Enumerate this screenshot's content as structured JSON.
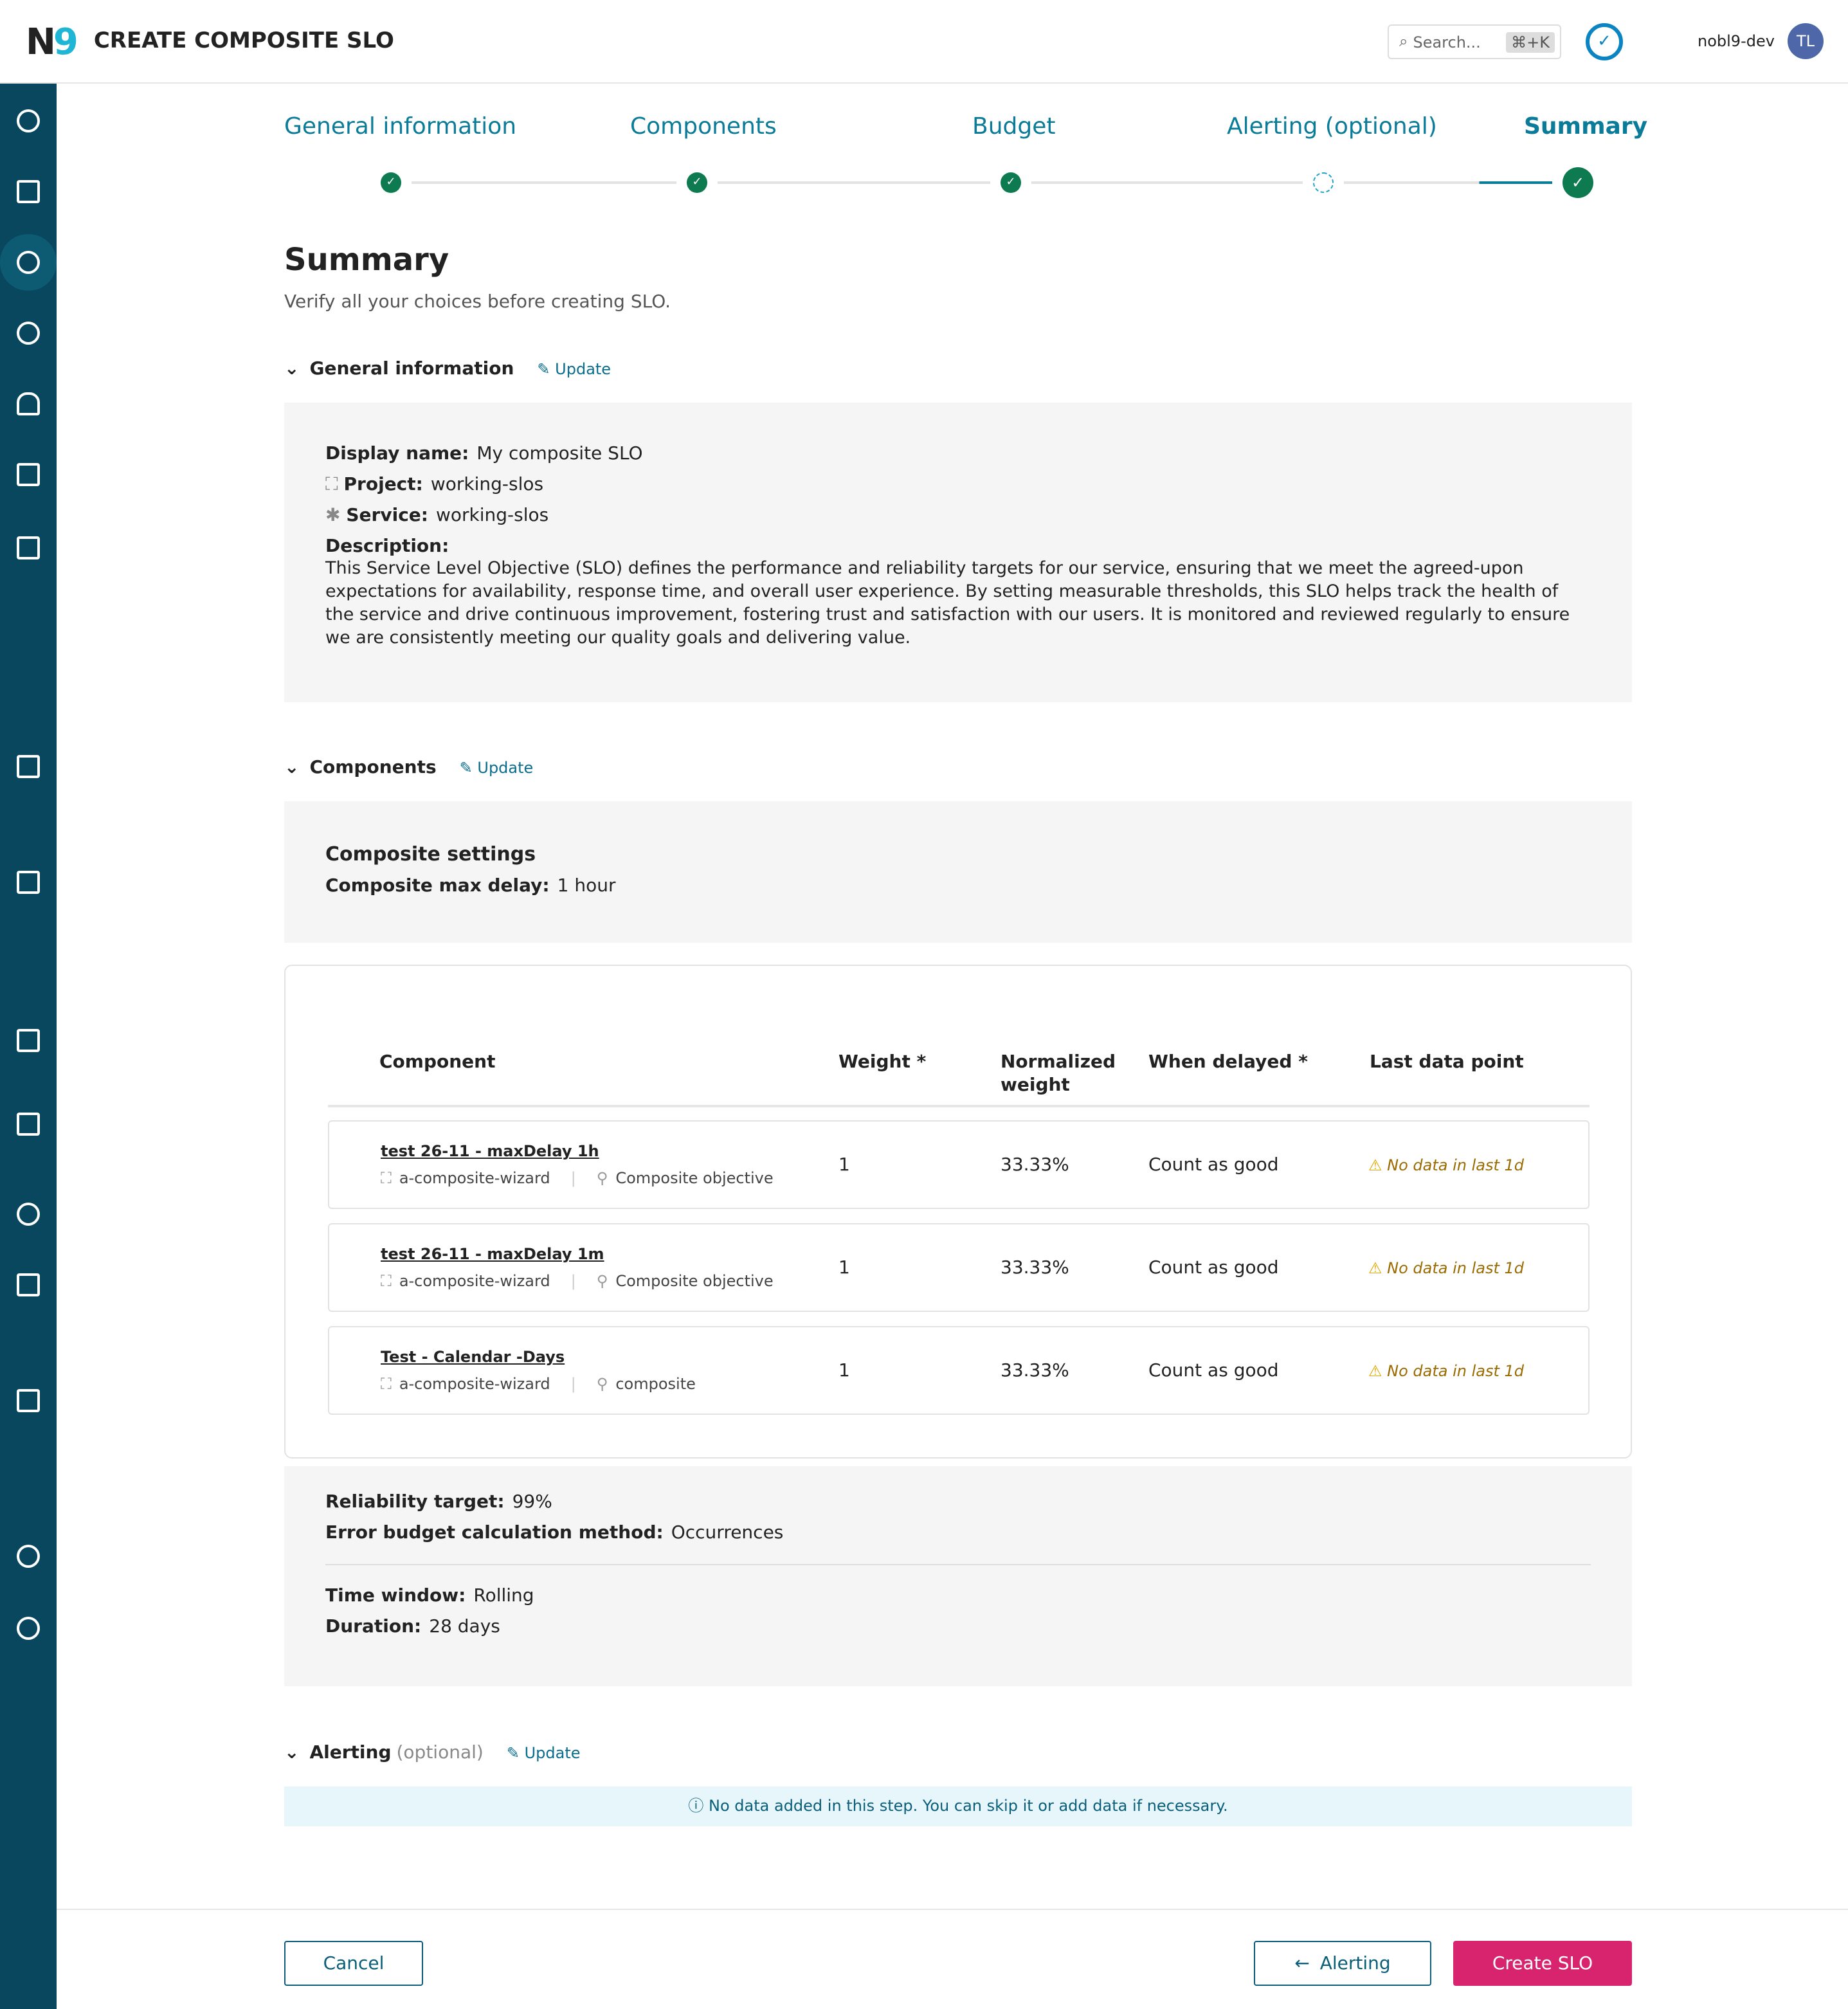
{
  "header": {
    "logo": "N9",
    "title": "CREATE COMPOSITE SLO",
    "search_placeholder": "Search...",
    "search_shortcut": "⌘+K",
    "username": "nobl9-dev",
    "avatar_initials": "TL"
  },
  "steps": [
    {
      "label": "General information",
      "status": "done"
    },
    {
      "label": "Components",
      "status": "done"
    },
    {
      "label": "Budget",
      "status": "done"
    },
    {
      "label": "Alerting (optional)",
      "status": "skipped"
    },
    {
      "label": "Summary",
      "status": "current"
    }
  ],
  "summary": {
    "title": "Summary",
    "subtitle": "Verify all your choices before creating SLO."
  },
  "general": {
    "heading": "General information",
    "update": "Update",
    "display_name_label": "Display name:",
    "display_name": "My composite SLO",
    "project_label": "Project:",
    "project": "working-slos",
    "service_label": "Service:",
    "service": "working-slos",
    "description_label": "Description:",
    "description": "This Service Level Objective (SLO) defines the performance and reliability targets for our service, ensuring that we meet the agreed-upon expectations for availability, response time, and overall user experience. By setting measurable thresholds, this SLO helps track the health of the service and drive continuous improvement, fostering trust and satisfaction with our users. It is monitored and reviewed regularly to ensure we are consistently meeting our quality goals and delivering value."
  },
  "components": {
    "heading": "Components",
    "update": "Update",
    "settings_title": "Composite settings",
    "max_delay_label": "Composite max delay:",
    "max_delay": "1 hour",
    "columns": [
      "Component",
      "Weight *",
      "Normalized weight",
      "When delayed *",
      "Last data point"
    ],
    "rows": [
      {
        "name": "test 26-11 - maxDelay 1h",
        "project": "a-composite-wizard",
        "objective": "Composite objective",
        "weight": "1",
        "normalized": "33.33%",
        "when_delayed": "Count as good",
        "last_data": "No data in last 1d"
      },
      {
        "name": "test 26-11 - maxDelay 1m",
        "project": "a-composite-wizard",
        "objective": "Composite objective",
        "weight": "1",
        "normalized": "33.33%",
        "when_delayed": "Count as good",
        "last_data": "No data in last 1d"
      },
      {
        "name": "Test - Calendar -Days",
        "project": "a-composite-wizard",
        "objective": "composite",
        "weight": "1",
        "normalized": "33.33%",
        "when_delayed": "Count as good",
        "last_data": "No data in last 1d"
      }
    ]
  },
  "budget": {
    "reliability_label": "Reliability target:",
    "reliability": "99%",
    "method_label": "Error budget calculation method:",
    "method": "Occurrences",
    "time_window_label": "Time window:",
    "time_window": "Rolling",
    "duration_label": "Duration:",
    "duration": "28 days"
  },
  "alerting": {
    "heading": "Alerting",
    "optional": "(optional)",
    "update": "Update",
    "info": "No data added in this step. You can skip it or add data if necessary."
  },
  "footer": {
    "cancel": "Cancel",
    "back": "Alerting",
    "create": "Create SLO"
  },
  "colors": {
    "primary": "#0a7c99",
    "success": "#0e7a4f",
    "sidebar": "#08475d",
    "create": "#d8236f",
    "warning": "#e0a800"
  }
}
